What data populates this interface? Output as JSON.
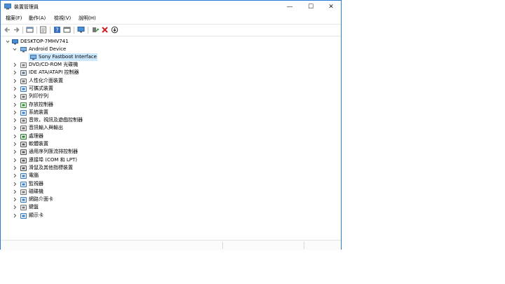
{
  "window": {
    "title": "裝置管理員",
    "minimize": "—",
    "maximize": "☐",
    "close": "✕"
  },
  "menu": [
    "檔案(F)",
    "動作(A)",
    "檢視(V)",
    "說明(H)"
  ],
  "toolbar": [
    "back-icon",
    "forward-icon",
    "properties-view-icon",
    "details-icon",
    "help-icon",
    "panel-icon",
    "monitor-icon",
    "update-driver-icon",
    "uninstall-icon",
    "disable-icon"
  ],
  "tree": {
    "root": "DESKTOP-7MHV741",
    "expanded": {
      "label": "Android Device",
      "child": "Sony Fastboot Interface"
    },
    "categories": [
      {
        "label": "DVD/CD-ROM 光碟機",
        "icon": "dvd-icon",
        "color": "#7a7a7a"
      },
      {
        "label": "IDE ATA/ATAPI 控制器",
        "icon": "ide-icon",
        "color": "#5a6e80"
      },
      {
        "label": "人性化介面裝置",
        "icon": "hid-icon",
        "color": "#6d6d6d"
      },
      {
        "label": "可攜式裝置",
        "icon": "portable-icon",
        "color": "#3c7ebf"
      },
      {
        "label": "列印佇列",
        "icon": "printer-icon",
        "color": "#6a6a6a"
      },
      {
        "label": "存放控制器",
        "icon": "storage-icon",
        "color": "#3a8a3a"
      },
      {
        "label": "系統裝置",
        "icon": "system-icon",
        "color": "#3c7ebf"
      },
      {
        "label": "音效，視訊及遊戲控制器",
        "icon": "audio-icon",
        "color": "#6a6a6a"
      },
      {
        "label": "音訊輸入與輸出",
        "icon": "audio-io-icon",
        "color": "#6a6a6a"
      },
      {
        "label": "處理器",
        "icon": "processor-icon",
        "color": "#2f7d32"
      },
      {
        "label": "軟體裝置",
        "icon": "software-icon",
        "color": "#555555"
      },
      {
        "label": "通用序列匯流排控制器",
        "icon": "usb-icon",
        "color": "#555555"
      },
      {
        "label": "連接埠 (COM 和 LPT)",
        "icon": "port-icon",
        "color": "#555555"
      },
      {
        "label": "滑鼠及其他指標裝置",
        "icon": "mouse-icon",
        "color": "#555555"
      },
      {
        "label": "電腦",
        "icon": "computer-icon",
        "color": "#3c7ebf"
      },
      {
        "label": "監視器",
        "icon": "monitor-icon",
        "color": "#3c7ebf"
      },
      {
        "label": "磁碟機",
        "icon": "disk-icon",
        "color": "#777777"
      },
      {
        "label": "網路介面卡",
        "icon": "network-icon",
        "color": "#3c7ebf"
      },
      {
        "label": "鍵盤",
        "icon": "keyboard-icon",
        "color": "#777777"
      },
      {
        "label": "顯示卡",
        "icon": "display-icon",
        "color": "#3c7ebf"
      }
    ]
  },
  "colors": {
    "accent": "#2b79d8",
    "selection": "#cce8ff"
  }
}
